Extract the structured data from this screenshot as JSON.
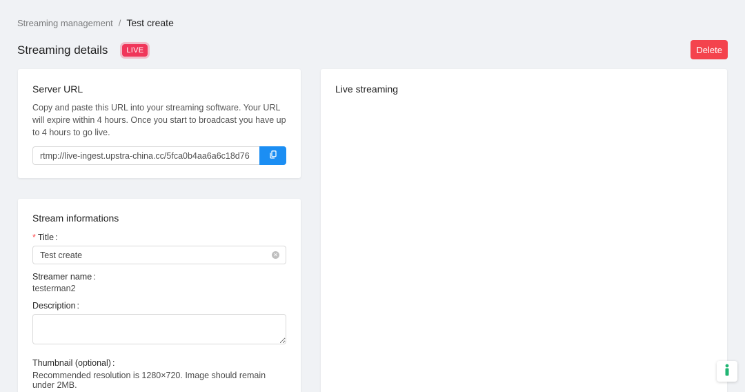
{
  "breadcrumb": {
    "parent": "Streaming management",
    "separator": "/",
    "current": "Test create"
  },
  "header": {
    "title": "Streaming details",
    "badge": "LIVE",
    "delete_label": "Delete"
  },
  "server_url": {
    "title": "Server URL",
    "description": "Copy and paste this URL into your streaming software. Your URL will expire within 4 hours. Once you start to broadcast you have up to 4 hours to go live.",
    "url_value": "rtmp://live-ingest.upstra-china.cc/5fca0b4aa6a6c18d76",
    "copy_icon": "copy-icon"
  },
  "stream_info": {
    "title": "Stream informations",
    "title_label": "Title",
    "title_value": "Test create",
    "streamer_label": "Streamer name",
    "streamer_value": "testerman2",
    "description_label": "Description",
    "description_value": "",
    "thumbnail_label": "Thumbnail (optional)",
    "thumbnail_note": "Recommended resolution is 1280×720. Image should remain under 2MB."
  },
  "live_streaming": {
    "title": "Live streaming"
  },
  "colors": {
    "accent": "#1b8ef3",
    "danger": "#f4434d",
    "live": "#f0365a",
    "background": "#f0f2f5"
  }
}
